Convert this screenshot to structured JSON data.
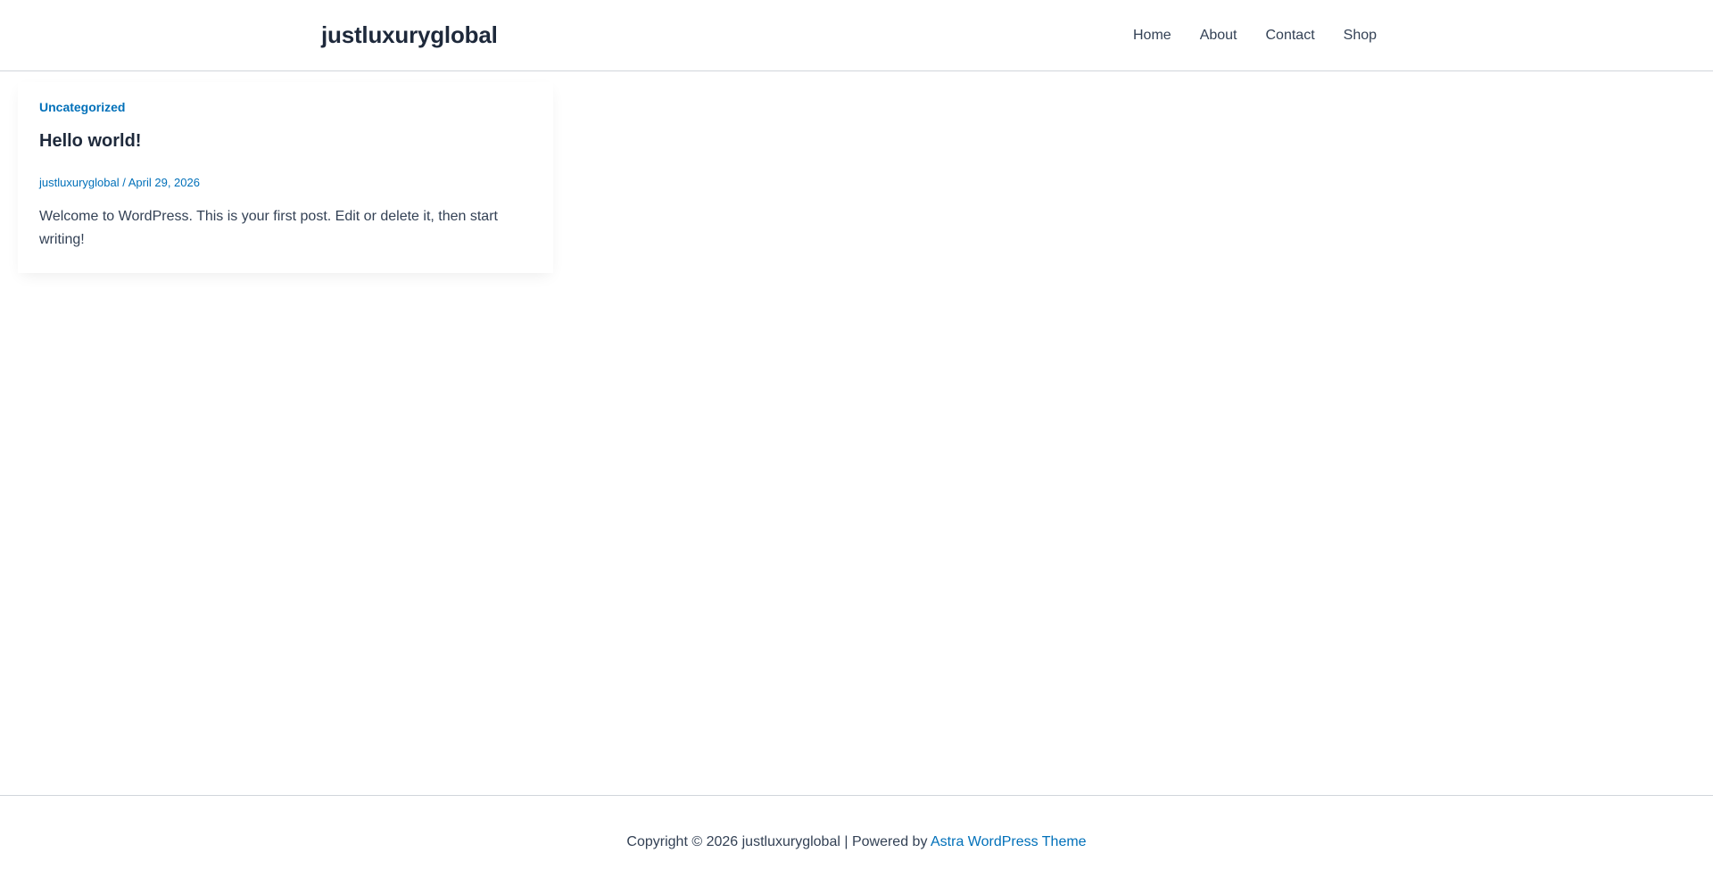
{
  "header": {
    "site_title": "justluxuryglobal",
    "nav": [
      {
        "label": "Home"
      },
      {
        "label": "About"
      },
      {
        "label": "Contact"
      },
      {
        "label": "Shop"
      }
    ]
  },
  "post": {
    "category": "Uncategorized",
    "title": "Hello world!",
    "author": "justluxuryglobal",
    "meta_separator": " / ",
    "date": "April 29, 2026",
    "excerpt": "Welcome to WordPress. This is your first post. Edit or delete it, then start writing!"
  },
  "footer": {
    "copyright_text": "Copyright © 2026 justluxuryglobal | Powered by ",
    "theme_link": "Astra WordPress Theme"
  },
  "colors": {
    "accent": "#0170b9",
    "heading": "#1e293b",
    "text": "#334155",
    "border": "#d1d5db"
  }
}
